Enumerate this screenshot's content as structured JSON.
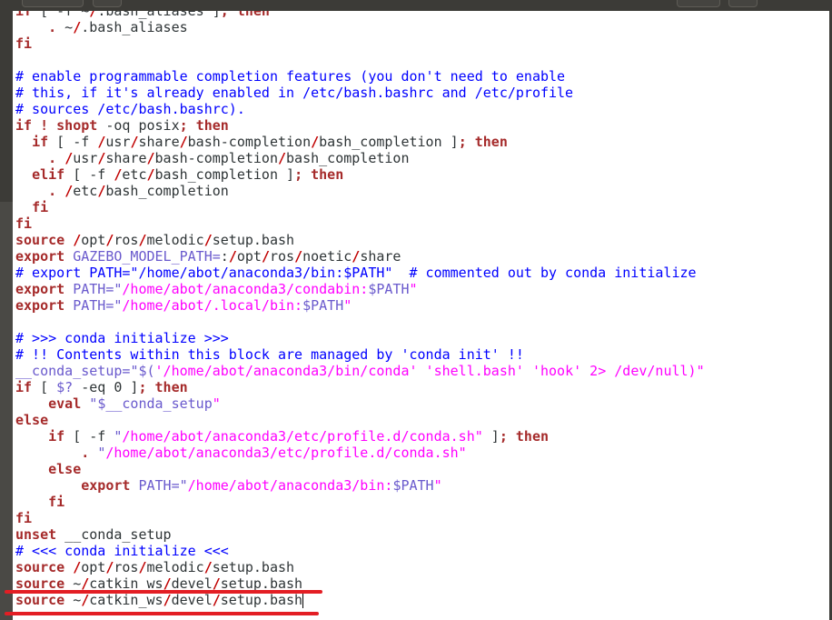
{
  "editor": {
    "lines": [
      "if [ -f ~/.bash_aliases ]; then",
      "    . ~/.bash_aliases",
      "fi",
      "",
      "# enable programmable completion features (you don't need to enable",
      "# this, if it's already enabled in /etc/bash.bashrc and /etc/profile",
      "# sources /etc/bash.bashrc).",
      "if ! shopt -oq posix; then",
      "  if [ -f /usr/share/bash-completion/bash_completion ]; then",
      "    . /usr/share/bash-completion/bash_completion",
      "  elif [ -f /etc/bash_completion ]; then",
      "    . /etc/bash_completion",
      "  fi",
      "fi",
      "source /opt/ros/melodic/setup.bash",
      "export GAZEBO_MODEL_PATH=:/opt/ros/noetic/share",
      "# export PATH=\"/home/abot/anaconda3/bin:$PATH\"  # commented out by conda initialize",
      "export PATH=\"/home/abot/anaconda3/condabin:$PATH\"",
      "export PATH=\"/home/abot/.local/bin:$PATH\"",
      "",
      "# >>> conda initialize >>>",
      "# !! Contents within this block are managed by 'conda init' !!",
      "__conda_setup=\"$('/home/abot/anaconda3/bin/conda' 'shell.bash' 'hook' 2> /dev/null)\"",
      "if [ $? -eq 0 ]; then",
      "    eval \"$__conda_setup\"",
      "else",
      "    if [ -f \"/home/abot/anaconda3/etc/profile.d/conda.sh\" ]; then",
      "        . \"/home/abot/anaconda3/etc/profile.d/conda.sh\"",
      "    else",
      "        export PATH=\"/home/abot/anaconda3/bin:$PATH\"",
      "    fi",
      "fi",
      "unset __conda_setup",
      "# <<< conda initialize <<<",
      "source /opt/ros/melodic/setup.bash",
      "source ~/catkin_ws/devel/setup.bash",
      "source ~/catkin_ws/devel/setup.bash"
    ],
    "caret_line": 36
  },
  "colors": {
    "keyword": "#a52a2a",
    "comment": "#0000ff",
    "string": "#ff00ff",
    "variable": "#6a5acd",
    "annotation": "#e31e24"
  }
}
